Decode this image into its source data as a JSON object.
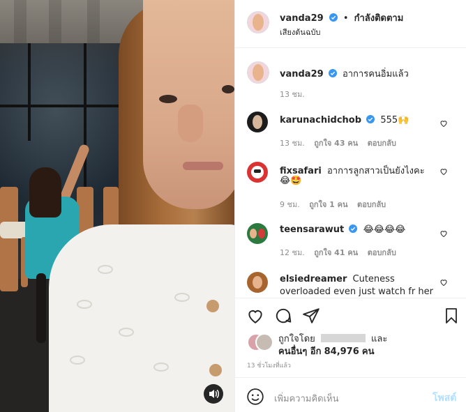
{
  "header": {
    "username": "vanda29",
    "separator": "•",
    "following_label": "กำลังติดตาม",
    "audio_label": "เสียงต้นฉบับ"
  },
  "caption": {
    "username": "vanda29",
    "text": "อาการคนอิ่มแล้ว",
    "time": "13 ชม."
  },
  "comments": [
    {
      "username": "karunachidchob",
      "verified": true,
      "text": "555🙌",
      "time": "13 ชม.",
      "likes": "ถูกใจ 43 คน",
      "reply": "ตอบกลับ"
    },
    {
      "username": "fixsafari",
      "verified": false,
      "text": "อาการลูกสาวเป็นยังไงคะ",
      "text2": "😂🤩",
      "time": "9 ชม.",
      "likes": "ถูกใจ 1 คน",
      "reply": "ตอบกลับ"
    },
    {
      "username": "teensarawut",
      "verified": true,
      "text": "😂😂😂😂",
      "time": "12 ชม.",
      "likes": "ถูกใจ 41 คน",
      "reply": "ตอบกลับ"
    },
    {
      "username": "elsiedreamer",
      "verified": false,
      "text": "Cuteness",
      "text2": "overloaded even just watch fr her"
    }
  ],
  "likes": {
    "liked_by_prefix": "ถูกใจโดย",
    "and_label": "และ",
    "others_prefix": "คนอื่นๆ อีก",
    "others_count": "84,976",
    "others_suffix": "คน"
  },
  "post_time": "13 ชั่วโมงที่แล้ว",
  "comment_box": {
    "placeholder": "เพิ่มความคิดเห็น",
    "post_label": "โพสต์"
  },
  "icons": {
    "verified": "verified-badge-icon",
    "heart": "heart-icon",
    "comment": "comment-icon",
    "share": "paper-plane-icon",
    "save": "bookmark-icon",
    "emoji": "smiley-icon",
    "sound": "speaker-icon"
  },
  "colors": {
    "verified": "#3897f0",
    "text": "#262626",
    "muted": "#8e8e8e",
    "post_disabled": "#b2dffc"
  }
}
